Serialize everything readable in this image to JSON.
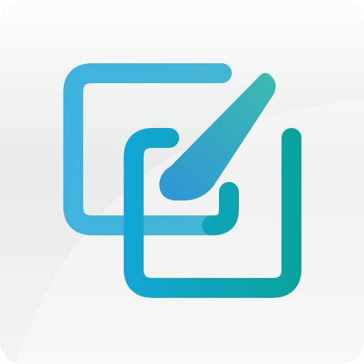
{
  "icon": {
    "name": "edit-squares-icon",
    "colors": {
      "tile_top": "#fdfdfd",
      "tile_mid": "#e9eaea",
      "tile_bottom": "#f4f4f4",
      "blue": "#3fb3e0",
      "cyan": "#13a6d6",
      "teal": "#08a39a",
      "pen_tip": "#2e99d2",
      "pen_end": "#3cb9b2"
    }
  }
}
